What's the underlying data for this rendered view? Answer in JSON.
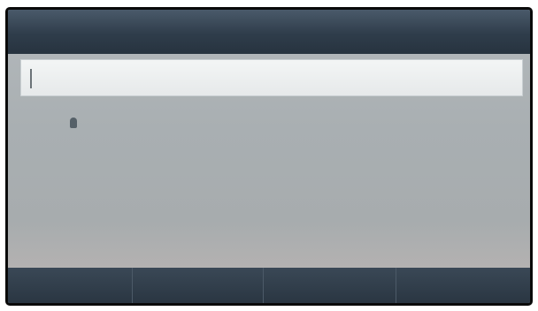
{
  "header": {
    "title": "",
    "right_label": ""
  },
  "search": {
    "value": ""
  },
  "results": [
    {
      "name": "",
      "detail": "",
      "number": "",
      "number_detail": ""
    }
  ],
  "softkeys": [
    {
      "label": ""
    },
    {
      "label": ""
    },
    {
      "label": ""
    },
    {
      "label": ""
    }
  ],
  "colors": {
    "title_bar": "#2f3d4b",
    "softkey_bar": "#2a3642",
    "screen_background": "#aeb3b6",
    "input_background": "#eef1f1"
  }
}
